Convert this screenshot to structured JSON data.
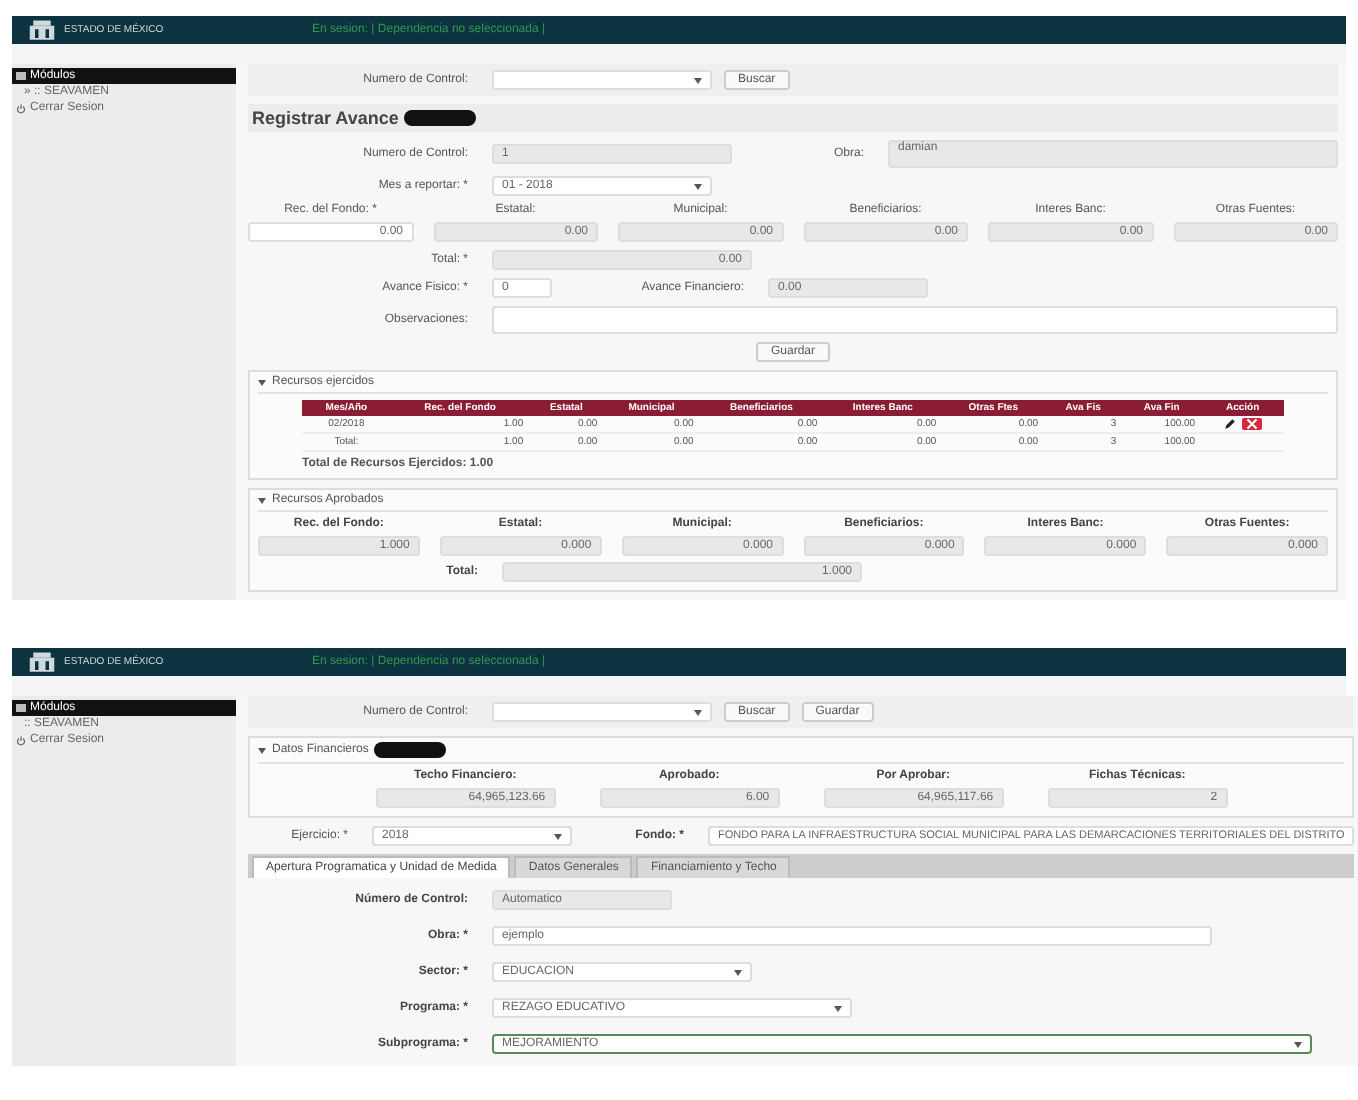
{
  "top": {
    "header": {
      "logo_text": "ESTADO DE MÉXICO",
      "session": "En sesion: | Dependencia no seleccionada |"
    },
    "sidebar": [
      {
        "label": "Módulos",
        "kind": "header"
      },
      {
        "label": "» :: SEAVAMEN",
        "kind": "link"
      },
      {
        "label": "Cerrar Sesion",
        "kind": "logout"
      }
    ],
    "search": {
      "label": "Numero de Control:",
      "button": "Buscar"
    },
    "form": {
      "title": "Registrar Avance",
      "control_label": "Numero de Control:",
      "control_value": "1",
      "obra_label": "Obra:",
      "obra_value": "damian",
      "month_label": "Mes a reportar: *",
      "month_value": "01 - 2018",
      "sources": [
        {
          "label": "Rec. del Fondo: *",
          "value": "0.00"
        },
        {
          "label": "Estatal:",
          "value": "0.00"
        },
        {
          "label": "Municipal:",
          "value": "0.00"
        },
        {
          "label": "Beneficiarios:",
          "value": "0.00"
        },
        {
          "label": "Interes Banc:",
          "value": "0.00"
        },
        {
          "label": "Otras Fuentes:",
          "value": "0.00"
        }
      ],
      "total_label": "Total: *",
      "total_value": "0.00",
      "fisico_label": "Avance Fisico: *",
      "fisico_value": "0",
      "fin_label": "Avance Financiero:",
      "fin_value": "0.00",
      "obs_label": "Observaciones:",
      "save": "Guardar"
    },
    "executed": {
      "title": "Recursos ejercidos",
      "columns": [
        "Mes/Año",
        "Rec. del Fondo",
        "Estatal",
        "Municipal",
        "Beneficiarios",
        "Interes Banc",
        "Otras Ftes",
        "Ava Fis",
        "Ava Fin",
        "Acción"
      ],
      "rows": [
        {
          "cells": [
            "02/2018",
            "1.00",
            "0.00",
            "0.00",
            "0.00",
            "0.00",
            "0.00",
            "3",
            "100.00"
          ],
          "actions": true
        },
        {
          "cells": [
            "Total:",
            "1.00",
            "0.00",
            "0.00",
            "0.00",
            "0.00",
            "0.00",
            "3",
            "100.00"
          ],
          "actions": false
        }
      ],
      "total_text": "Total de Recursos Ejercidos: 1.00"
    },
    "approved": {
      "title": "Recursos Aprobados",
      "sources": [
        {
          "label": "Rec. del Fondo:",
          "value": "1.000"
        },
        {
          "label": "Estatal:",
          "value": "0.000"
        },
        {
          "label": "Municipal:",
          "value": "0.000"
        },
        {
          "label": "Beneficiarios:",
          "value": "0.000"
        },
        {
          "label": "Interes Banc:",
          "value": "0.000"
        },
        {
          "label": "Otras Fuentes:",
          "value": "0.000"
        }
      ],
      "total_label": "Total:",
      "total_value": "1.000"
    }
  },
  "bottom": {
    "header": {
      "logo_text": "ESTADO DE MÉXICO",
      "session": "En sesion: | Dependencia no seleccionada |"
    },
    "sidebar": [
      {
        "label": "Módulos",
        "kind": "header"
      },
      {
        "label": ":: SEAVAMEN",
        "kind": "link"
      },
      {
        "label": "Cerrar Sesion",
        "kind": "logout"
      }
    ],
    "search": {
      "label": "Numero de Control:",
      "buttons": [
        "Buscar",
        "Guardar"
      ]
    },
    "financial": {
      "title": "Datos Financieros",
      "stats": [
        {
          "label": "Techo Financiero:",
          "value": "64,965,123.66"
        },
        {
          "label": "Aprobado:",
          "value": "6.00"
        },
        {
          "label": "Por Aprobar:",
          "value": "64,965,117.66"
        },
        {
          "label": "Fichas Técnicas:",
          "value": "2"
        }
      ]
    },
    "year_label": "Ejercicio: *",
    "year_value": "2018",
    "fund_label": "Fondo: *",
    "fund_value": "FONDO PARA LA INFRAESTRUCTURA SOCIAL MUNICIPAL PARA LAS DEMARCACIONES TERRITORIALES DEL DISTRITO",
    "tabs": [
      {
        "label": "Apertura Programatica y Unidad de Medida",
        "selected": true
      },
      {
        "label": "Datos Generales",
        "selected": false
      },
      {
        "label": "Financiamiento y Techo",
        "selected": false
      }
    ],
    "fields": [
      {
        "label": "Número de Control:",
        "value": "Automatico",
        "kind": "readonly",
        "focused": false
      },
      {
        "label": "Obra: *",
        "value": "ejemplo",
        "kind": "text",
        "focused": false
      },
      {
        "label": "Sector: *",
        "value": "EDUCACION",
        "kind": "select",
        "focused": false
      },
      {
        "label": "Programa: *",
        "value": "REZAGO EDUCATIVO",
        "kind": "select",
        "focused": false
      },
      {
        "label": "Subprograma: *",
        "value": "MEJORAMIENTO",
        "kind": "select",
        "focused": true
      }
    ]
  }
}
